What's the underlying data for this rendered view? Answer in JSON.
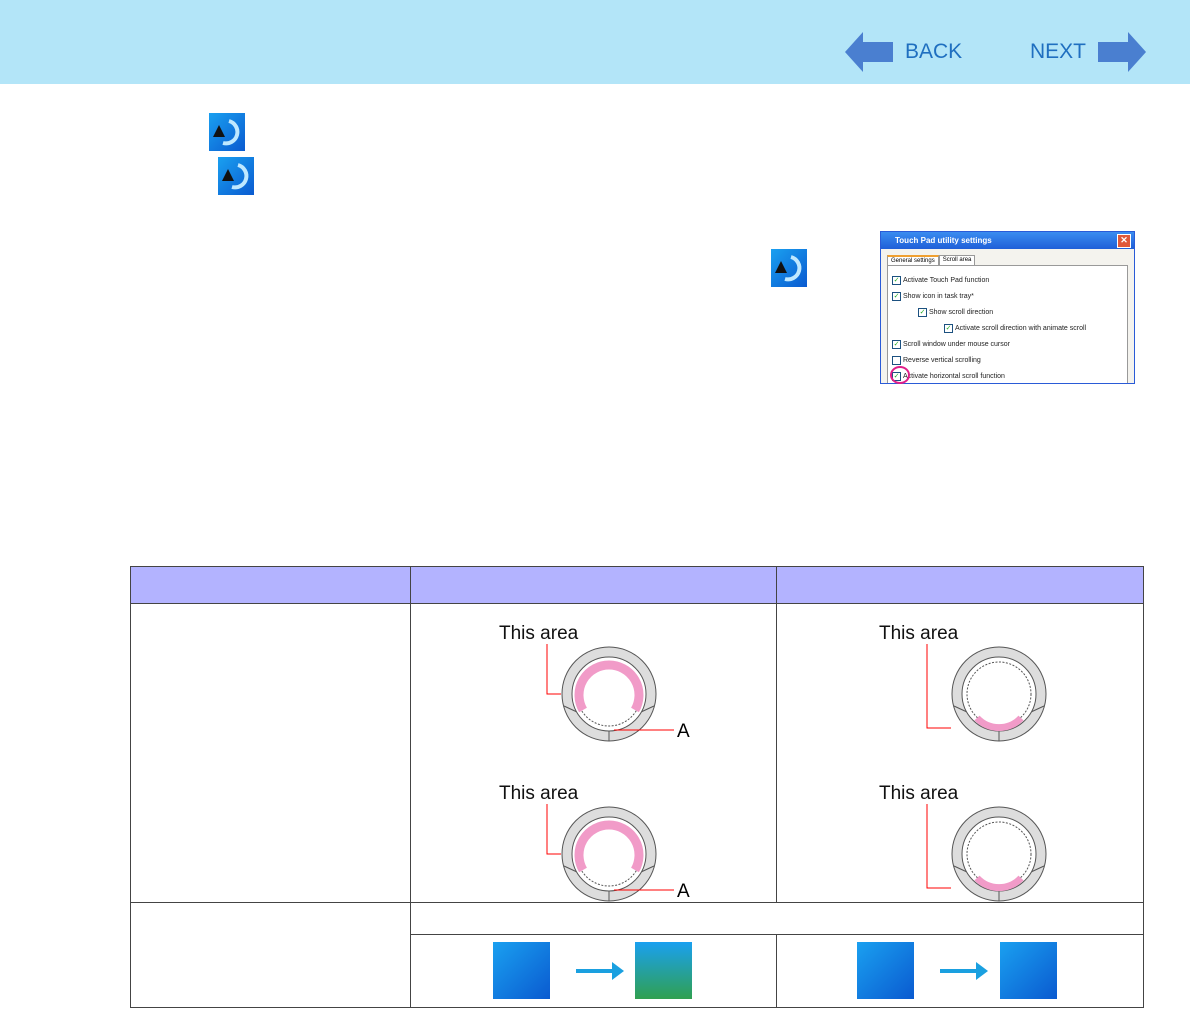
{
  "nav": {
    "back": "BACK",
    "next": "NEXT"
  },
  "dialog": {
    "title": "Touch Pad utility settings",
    "close": "✕",
    "tabs": [
      "General settings",
      "Scroll area"
    ],
    "options": [
      {
        "label": "Activate Touch Pad function",
        "checked": true,
        "indent": 0
      },
      {
        "label": "Show icon in task tray*",
        "checked": true,
        "indent": 0
      },
      {
        "label": "Show scroll direction",
        "checked": true,
        "indent": 1
      },
      {
        "label": "Activate scroll direction with animate scroll",
        "checked": true,
        "indent": 2
      },
      {
        "label": "Scroll window under mouse cursor",
        "checked": true,
        "indent": 0
      },
      {
        "label": "Reverse vertical scrolling",
        "checked": false,
        "indent": 0
      },
      {
        "label": "Activate horizontal scroll function",
        "checked": true,
        "indent": 0
      }
    ]
  },
  "diagrams": {
    "label": "This area",
    "a_label": "A"
  },
  "colors": {
    "header": "#b3e5f8",
    "table_header": "#b3b3ff",
    "scroll_area": "#f19bc8",
    "accent": "#1f6fc0"
  }
}
